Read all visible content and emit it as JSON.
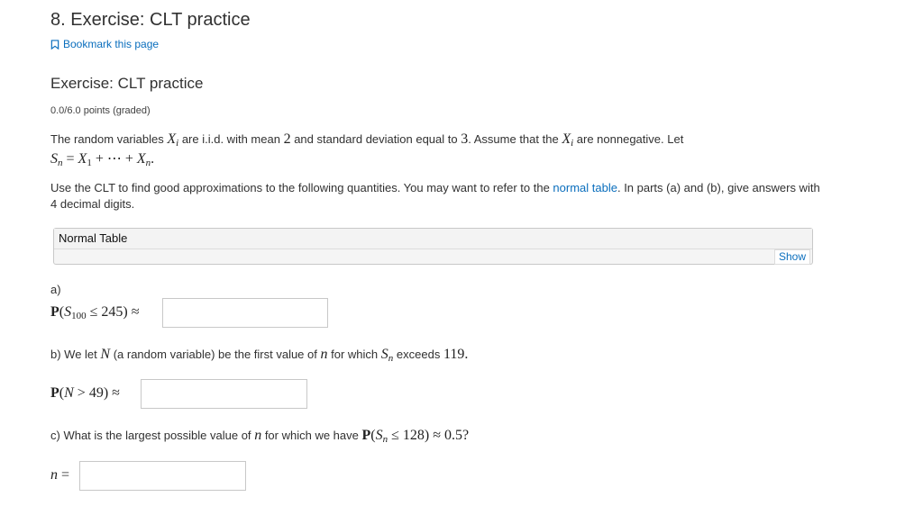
{
  "header": {
    "title": "8. Exercise: CLT practice",
    "bookmark_label": "Bookmark this page"
  },
  "problem": {
    "title": "Exercise: CLT practice",
    "points": "0.0/6.0 points (graded)",
    "intro_1": "The random variables",
    "intro_2": "are i.i.d. with mean",
    "mean": "2",
    "intro_3": "and standard deviation equal to",
    "sd": "3",
    "intro_4": ". Assume that the",
    "intro_5": "are nonnegative. Let",
    "instructions_1": "Use the CLT to find good approximations to the following quantities. You may want to refer to the",
    "normal_table_link": "normal table",
    "instructions_2": ". In parts (a) and (b), give answers with 4 decimal digits."
  },
  "normal_table": {
    "label": "Normal Table",
    "show_label": "Show"
  },
  "part_a": {
    "label": "a)",
    "bound": "245",
    "sub": "100",
    "value": ""
  },
  "part_b": {
    "text_1": "b) We let",
    "text_2": "(a random variable) be the first value of",
    "text_3": "for which",
    "text_4": "exceeds",
    "threshold": "119",
    "bound": "49",
    "value": ""
  },
  "part_c": {
    "text_1": "c) What is the largest possible value of",
    "text_2": "for which we have",
    "bound": "128",
    "prob": "0.5",
    "value": ""
  }
}
